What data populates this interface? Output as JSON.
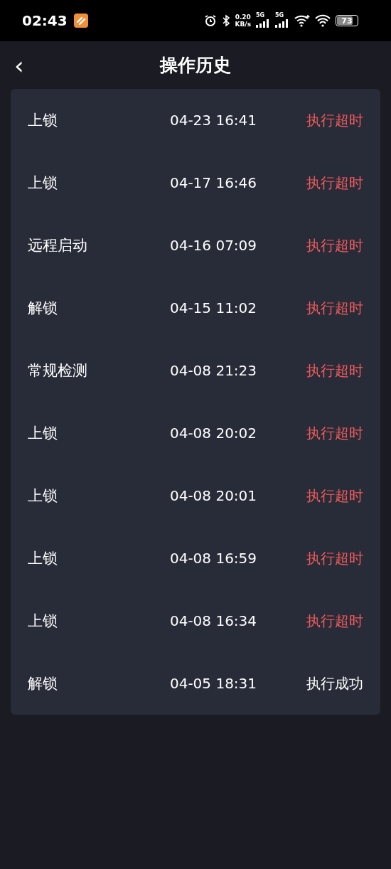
{
  "status_bar": {
    "time": "02:43",
    "speed_value": "0.20",
    "speed_unit": "KB/s",
    "sim_1": "5G",
    "sim_2": "5G",
    "battery": "73"
  },
  "header": {
    "back": "‹",
    "title": "操作历史"
  },
  "history": [
    {
      "action": "上锁",
      "time": "04-23 16:41",
      "result": "执行超时",
      "failed": true
    },
    {
      "action": "上锁",
      "time": "04-17 16:46",
      "result": "执行超时",
      "failed": true
    },
    {
      "action": "远程启动",
      "time": "04-16 07:09",
      "result": "执行超时",
      "failed": true
    },
    {
      "action": "解锁",
      "time": "04-15 11:02",
      "result": "执行超时",
      "failed": true
    },
    {
      "action": "常规检测",
      "time": "04-08 21:23",
      "result": "执行超时",
      "failed": true
    },
    {
      "action": "上锁",
      "time": "04-08 20:02",
      "result": "执行超时",
      "failed": true
    },
    {
      "action": "上锁",
      "time": "04-08 20:01",
      "result": "执行超时",
      "failed": true
    },
    {
      "action": "上锁",
      "time": "04-08 16:59",
      "result": "执行超时",
      "failed": true
    },
    {
      "action": "上锁",
      "time": "04-08 16:34",
      "result": "执行超时",
      "failed": true
    },
    {
      "action": "解锁",
      "time": "04-05 18:31",
      "result": "执行成功",
      "failed": false
    }
  ]
}
